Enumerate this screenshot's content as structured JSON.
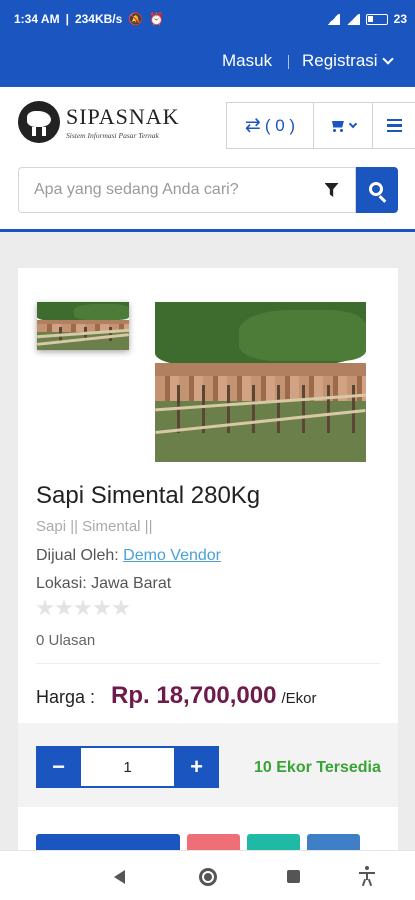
{
  "status_bar": {
    "time": "1:34 AM",
    "speed": "234KB/s",
    "battery": "23"
  },
  "top_nav": {
    "login": "Masuk",
    "register": "Registrasi"
  },
  "logo": {
    "name": "SIPASNAK",
    "tagline": "Sistem Informasi Pasar Ternak"
  },
  "header": {
    "compare_count": "( 0 )"
  },
  "search": {
    "placeholder": "Apa yang sedang Anda cari?"
  },
  "product": {
    "title": "Sapi Simental 280Kg",
    "categories": "Sapi || Simental ||",
    "seller_label": "Dijual Oleh:",
    "seller_name": "Demo Vendor",
    "location": "Lokasi: Jawa Barat",
    "rating": 0,
    "reviews": "0 Ulasan",
    "price_label": "Harga :",
    "price": "Rp. 18,700,000",
    "unit": "/Ekor",
    "quantity": "1",
    "stock": "10 Ekor Tersedia"
  },
  "quantity_controls": {
    "minus": "−",
    "plus": "+"
  },
  "icons": {
    "compare": "swap-arrows-icon",
    "cart": "cart-icon",
    "menu": "hamburger-icon",
    "filter": "filter-icon",
    "search": "search-icon"
  },
  "colors": {
    "primary": "#1b55c0",
    "price": "#6e1b4b",
    "stock": "#3aa335",
    "link": "#4aa0d8"
  }
}
